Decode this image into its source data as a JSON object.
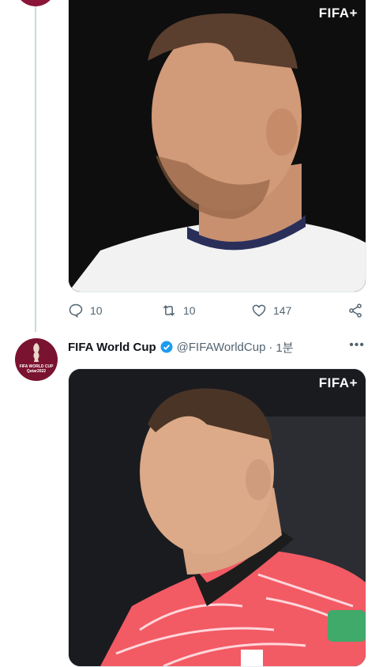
{
  "tweet1": {
    "media": {
      "watermark": "FIFA+"
    },
    "actions": {
      "replies": "10",
      "retweets": "10",
      "likes": "147"
    }
  },
  "tweet2": {
    "author": {
      "name": "FIFA World Cup",
      "handle": "@FIFAWorldCup",
      "separator": "·",
      "time": "1분"
    },
    "avatar": {
      "text_line1": "FIFA WORLD CUP",
      "text_line2": "Qatar2022"
    },
    "media": {
      "watermark": "FIFA+"
    },
    "more_label": "•••"
  },
  "colors": {
    "brand": "#8a1538",
    "verified": "#1d9bf0",
    "muted": "#536471"
  }
}
